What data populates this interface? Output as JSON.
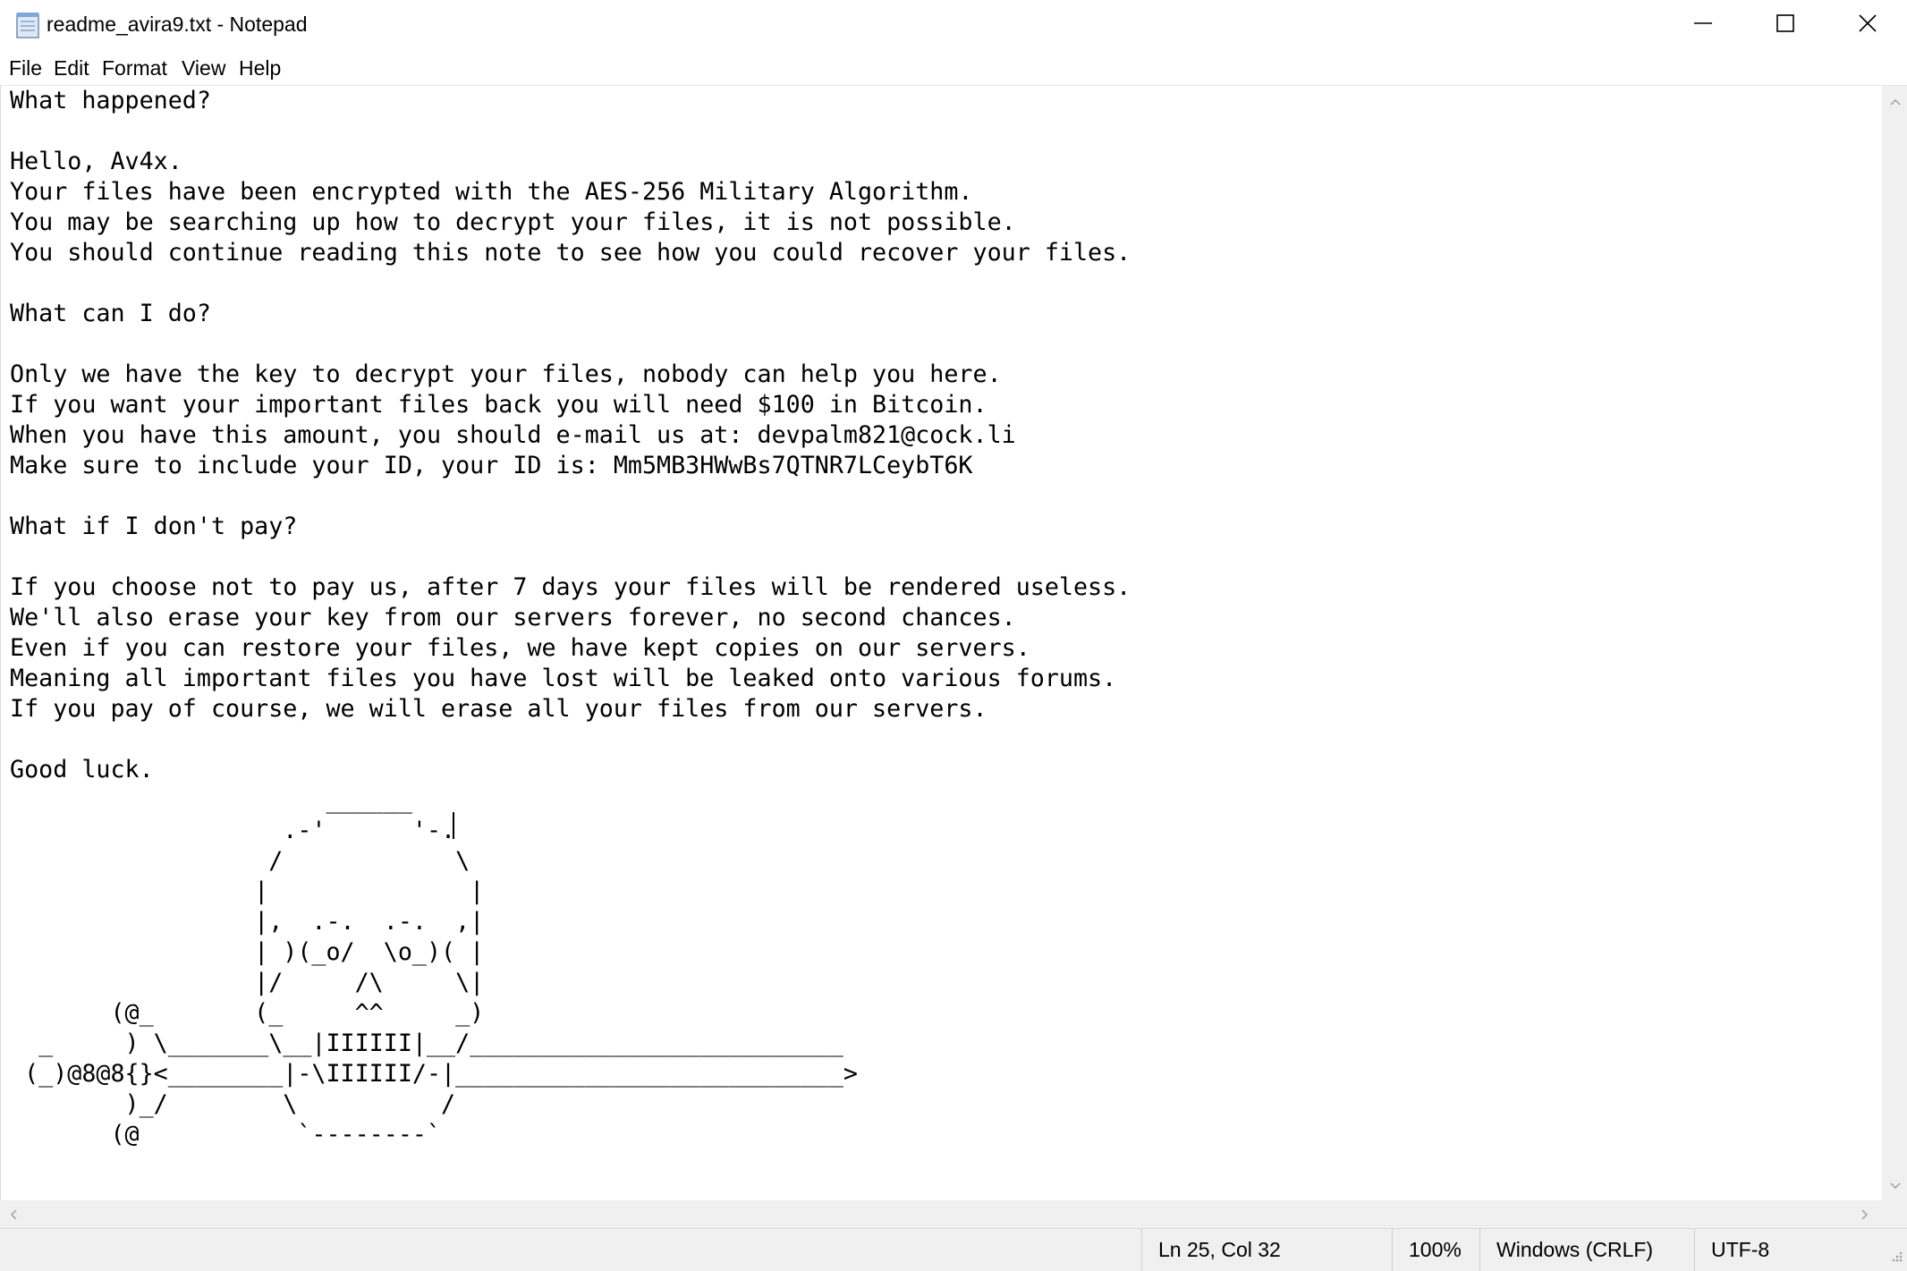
{
  "window": {
    "title": "readme_avira9.txt - Notepad",
    "app_icon": "notepad-icon",
    "controls": {
      "minimize_icon": "minimize-icon",
      "maximize_icon": "maximize-icon",
      "close_icon": "close-icon"
    }
  },
  "menu": {
    "items": [
      {
        "label": "File"
      },
      {
        "label": "Edit"
      },
      {
        "label": "Format"
      },
      {
        "label": "View"
      },
      {
        "label": "Help"
      }
    ]
  },
  "editor": {
    "content": "What happened?\n\nHello, Av4x.\nYour files have been encrypted with the AES-256 Military Algorithm.\nYou may be searching up how to decrypt your files, it is not possible.\nYou should continue reading this note to see how you could recover your files.\n\nWhat can I do?\n\nOnly we have the key to decrypt your files, nobody can help you here.\nIf you want your important files back you will need $100 in Bitcoin.\nWhen you have this amount, you should e-mail us at: devpalm821@cock.li\nMake sure to include your ID, your ID is: Mm5MB3HWwBs7QTNR7LCeybT6K\n\nWhat if I don't pay?\n\nIf you choose not to pay us, after 7 days your files will be rendered useless.\nWe'll also erase your key from our servers forever, no second chances.\nEven if you can restore your files, we have kept copies on our servers.\nMeaning all important files you have lost will be leaked onto various forums.\nIf you pay of course, we will erase all your files from our servers.\n\nGood luck.\n                      ______\n                   .-'      '-.\n                  /            \\\n                 |              |\n                 |,  .-.  .-.  ,|\n                 | )(_o/  \\o_)( |\n                 |/     /\\     \\|\n       (@_       (_     ^^     _)\n  _     ) \\_______\\__|IIIIII|__/__________________________\n (_)@8@8{}<________|-\\IIIIII/-|___________________________>\n        )_/        \\          /\n       (@           `--------`"
  },
  "status": {
    "position": "Ln 25, Col 32",
    "zoom": "100%",
    "line_endings": "Windows (CRLF)",
    "encoding": "UTF-8"
  }
}
